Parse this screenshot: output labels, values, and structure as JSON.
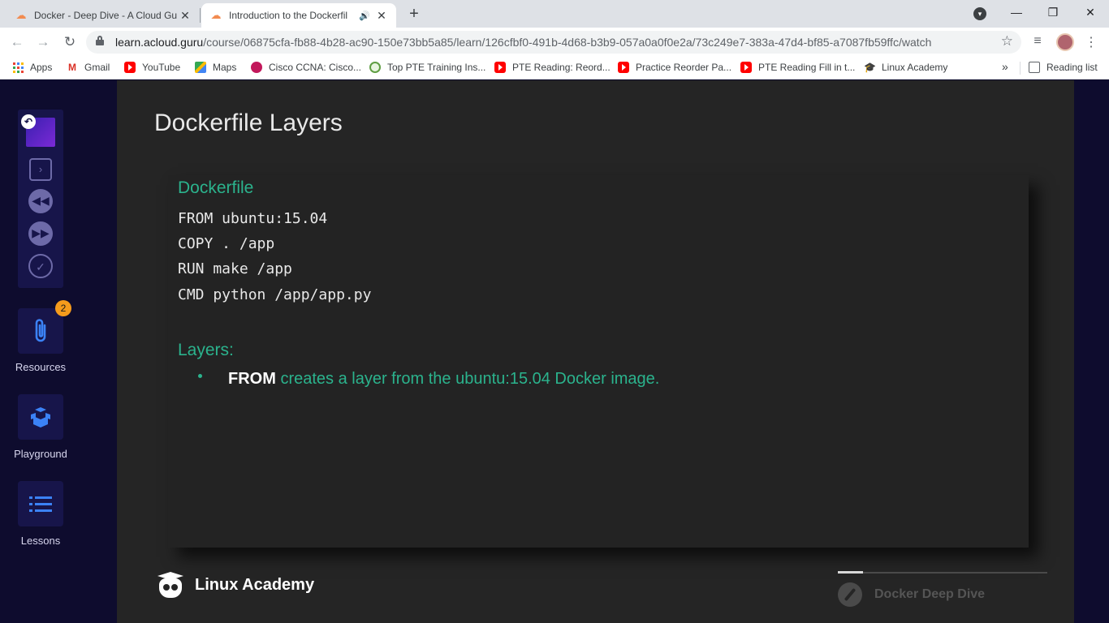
{
  "browser": {
    "tabs": [
      {
        "title": "Docker - Deep Dive - A Cloud Gu",
        "active": false
      },
      {
        "title": "Introduction to the Dockerfil",
        "active": true,
        "audio": true
      }
    ],
    "url": {
      "domain": "learn.acloud.guru",
      "path": "/course/06875cfa-fb88-4b28-ac90-150e73bb5a85/learn/126cfbf0-491b-4d68-b3b9-057a0a0f0e2a/73c249e7-383a-47d4-bf85-a7087fb59ffc/watch"
    },
    "bookmarks": [
      {
        "label": "Apps",
        "icon": "apps-grid-icon"
      },
      {
        "label": "Gmail",
        "icon": "gmail-icon"
      },
      {
        "label": "YouTube",
        "icon": "youtube-icon"
      },
      {
        "label": "Maps",
        "icon": "maps-icon"
      },
      {
        "label": "Cisco CCNA: Cisco...",
        "icon": "cisco-icon"
      },
      {
        "label": "Top PTE Training Ins...",
        "icon": "pte-icon"
      },
      {
        "label": "PTE Reading: Reord...",
        "icon": "youtube-icon"
      },
      {
        "label": "Practice Reorder Pa...",
        "icon": "youtube-icon"
      },
      {
        "label": "PTE Reading Fill in t...",
        "icon": "youtube-icon"
      },
      {
        "label": "Linux Academy",
        "icon": "graduation-cap-icon"
      }
    ],
    "more": "»",
    "reading_list": "Reading list"
  },
  "sidebar": {
    "resources": {
      "label": "Resources",
      "badge": "2"
    },
    "playground": {
      "label": "Playground"
    },
    "lessons": {
      "label": "Lessons"
    }
  },
  "slide": {
    "title": "Dockerfile Layers",
    "card_heading": "Dockerfile",
    "code_lines": [
      "FROM ubuntu:15.04",
      "COPY . /app",
      "RUN make /app",
      "CMD python /app/app.py"
    ],
    "layers_heading": "Layers:",
    "bullet_keyword": "FROM",
    "bullet_text": " creates a layer from the ubuntu:15.04 Docker image.",
    "brand": "Linux Academy",
    "course": "Docker Deep Dive",
    "progress_fraction": 0.12
  },
  "colors": {
    "accent_green": "#2bb38d",
    "sidebar_bg": "#0e0c2e",
    "badge_orange": "#f59b1c"
  }
}
